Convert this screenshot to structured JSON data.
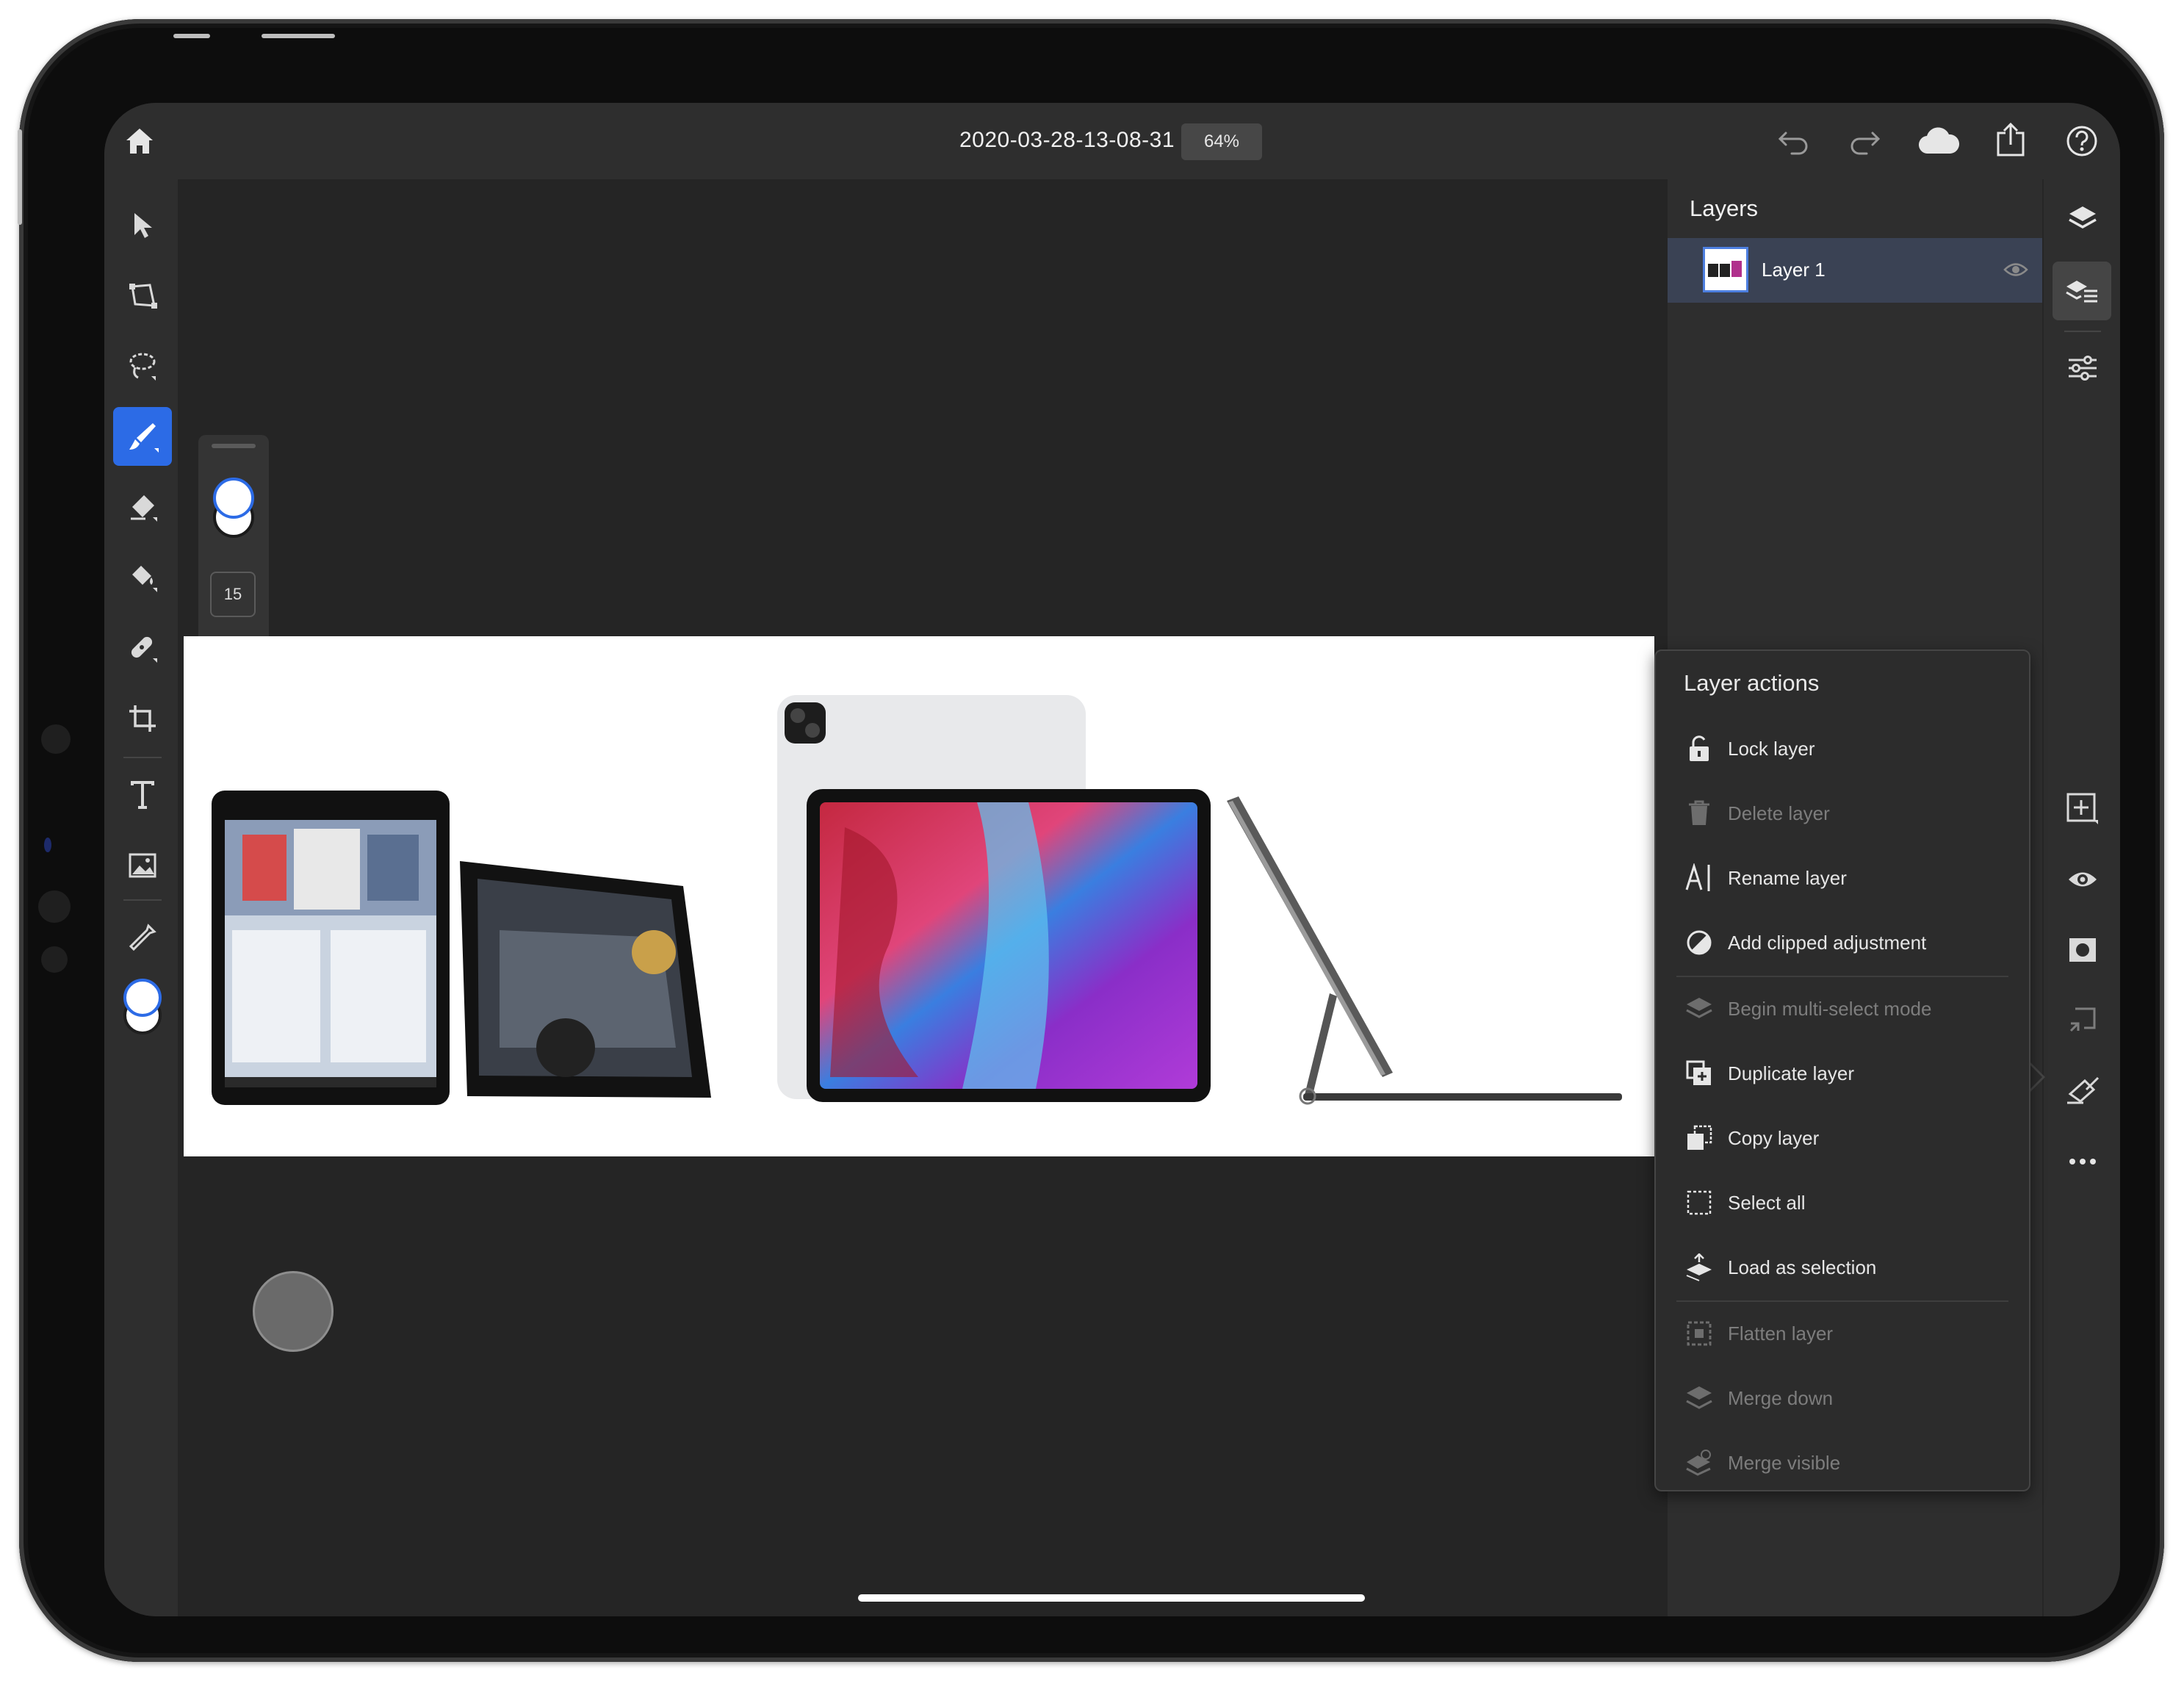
{
  "header": {
    "document_title": "2020-03-28-13-08-31",
    "zoom": "64%"
  },
  "tool_options": {
    "brush_size": "15"
  },
  "layers_panel": {
    "title": "Layers",
    "layers": [
      {
        "name": "Layer 1",
        "selected": true,
        "visible": true
      }
    ]
  },
  "layer_actions_menu": {
    "title": "Layer actions",
    "items": [
      {
        "label": "Lock layer",
        "enabled": true,
        "icon": "lock-icon"
      },
      {
        "label": "Delete layer",
        "enabled": false,
        "icon": "trash-icon"
      },
      {
        "label": "Rename layer",
        "enabled": true,
        "icon": "rename-icon"
      },
      {
        "label": "Add clipped adjustment",
        "enabled": true,
        "icon": "adjustment-icon"
      },
      {
        "label": "Begin multi-select mode",
        "enabled": false,
        "icon": "layers-stack-icon"
      },
      {
        "label": "Duplicate layer",
        "enabled": true,
        "icon": "duplicate-icon"
      },
      {
        "label": "Copy layer",
        "enabled": true,
        "icon": "copy-icon"
      },
      {
        "label": "Select all",
        "enabled": true,
        "icon": "select-all-icon"
      },
      {
        "label": "Load as selection",
        "enabled": true,
        "icon": "load-selection-icon"
      },
      {
        "label": "Flatten layer",
        "enabled": false,
        "icon": "flatten-icon"
      },
      {
        "label": "Merge down",
        "enabled": false,
        "icon": "merge-down-icon"
      },
      {
        "label": "Merge visible",
        "enabled": false,
        "icon": "merge-visible-icon"
      }
    ]
  },
  "colors": {
    "accent": "#2c6be6",
    "toolbar_bg": "#2e2e2e",
    "canvas_bg": "#252525",
    "selected_layer_bg": "#3a4254"
  }
}
